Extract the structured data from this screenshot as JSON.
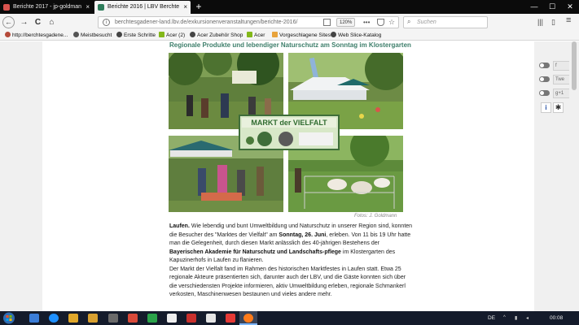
{
  "tabs": [
    {
      "title": "Berichte 2017 - jp-goldmann.d",
      "close": "×"
    },
    {
      "title": "Berichte 2016 | LBV Berchtesgad",
      "close": "×"
    }
  ],
  "new_tab_label": "+",
  "window_controls": {
    "minimize": "—",
    "maximize": "☐",
    "close": "✕"
  },
  "nav": {
    "back": "←",
    "forward": "→",
    "reload": "C",
    "home": "⌂",
    "url": "berchtesgadener-land.lbv.de/exkursionenveranstaltungen/berichte-2016/",
    "zoom": "120%",
    "page_actions": "•••",
    "bookmark_star": "☆",
    "search_placeholder": "Suchen",
    "right_icons": {
      "library": "|||",
      "sidebar": "▯",
      "menu": "≡"
    }
  },
  "bookmarks": [
    {
      "label": "http://berchtesgadene...",
      "icon": "globe-icon"
    },
    {
      "label": "Meistbesucht",
      "icon": "gear-icon"
    },
    {
      "label": "Erste Schritte",
      "icon": "globe-icon"
    },
    {
      "label": "Acer (2)",
      "icon": "acer-icon"
    },
    {
      "label": "Acer Zubehör Shop",
      "icon": "globe-icon"
    },
    {
      "label": "Acer",
      "icon": "acer-icon"
    },
    {
      "label": "Vorgeschlagene Sites",
      "icon": "folder-icon"
    },
    {
      "label": "Web Slice-Katalog",
      "icon": "globe-icon"
    }
  ],
  "page": {
    "subheading": "Regionale Produkte und lebendiger Naturschutz am Sonntag im Klostergarten",
    "banner": {
      "title": "MARKT der VIELFALT"
    },
    "photo_caption": "Fotos: J. Goldmann",
    "article": {
      "lead": "Laufen.",
      "p1a": "  Wie lebendig und bunt Umweltbildung und Naturschutz in unserer Region sind, konnten die Besucher des \"Marktes der Vielfalt\" am ",
      "p1b": "Sonntag, 26. Juni",
      "p1c": ", erleben. Von 11 bis 19 Uhr hatte man die Gelegenheit, durch diesen Markt anlässlich des 40-jährigen Bestehens der ",
      "p1d": "Bayerischen Akademie für Naturschutz und Landschafts-pflege",
      "p1e": " im Klostergarten des Kapuzinerhofs in Laufen zu flanieren.",
      "p2": "Der Markt der Vielfalt fand im Rahmen des historischen Marktfestes in Laufen statt. Etwa 25 regionale Akteure präsentierten sich, darunter auch der LBV, und die Gäste konnten sich über die verschiedensten Projekte informieren, aktiv Umweltbildung erleben, regionale Schmankerl verkosten, Maschinenwesen bestaunen und vieles andere mehr."
    }
  },
  "social": {
    "facebook": "f",
    "twitter": "Twe",
    "gplus": "g+1",
    "info": "i",
    "settings": "✱"
  },
  "taskbar": {
    "language": "DE",
    "time": "00:08"
  }
}
